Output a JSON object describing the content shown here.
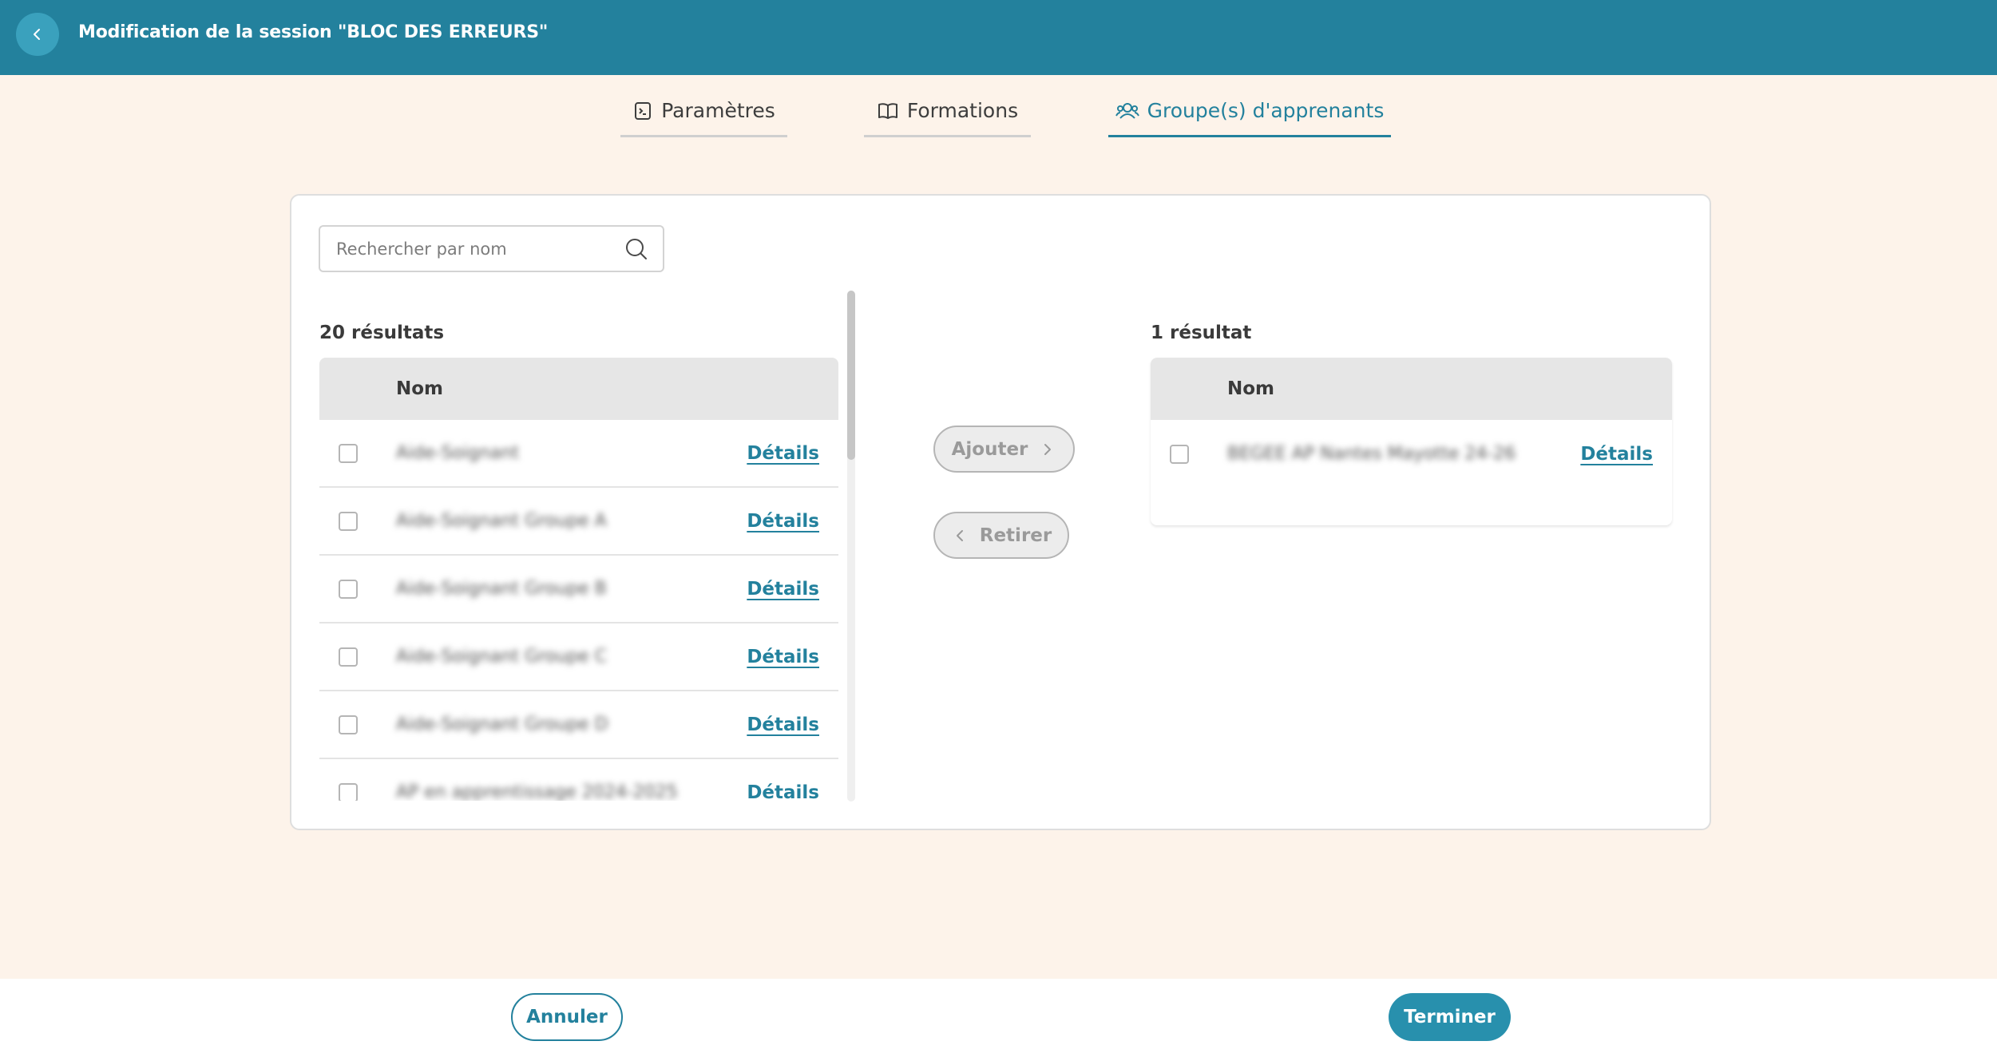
{
  "header": {
    "title": "Modification de la session \"BLOC DES ERREURS\""
  },
  "tabs": [
    {
      "label": "Paramètres",
      "icon": "settings-doc-icon"
    },
    {
      "label": "Formations",
      "icon": "book-icon"
    },
    {
      "label": "Groupe(s) d'apprenants",
      "icon": "users-icon",
      "active": true
    }
  ],
  "search": {
    "placeholder": "Rechercher par nom",
    "value": ""
  },
  "left": {
    "count": "20 résultats",
    "column": "Nom",
    "rows": [
      {
        "name": "Aide-Soignant",
        "action": "Détails"
      },
      {
        "name": "Aide-Soignant Groupe A",
        "action": "Détails"
      },
      {
        "name": "Aide-Soignant Groupe B",
        "action": "Détails"
      },
      {
        "name": "Aide-Soignant Groupe C",
        "action": "Détails"
      },
      {
        "name": "Aide-Soignant Groupe D",
        "action": "Détails"
      },
      {
        "name": "AP en apprentissage 2024-2025",
        "action": "Détails"
      }
    ]
  },
  "actions": {
    "add": "Ajouter",
    "remove": "Retirer"
  },
  "right": {
    "count": "1 résultat",
    "column": "Nom",
    "rows": [
      {
        "name": "BEGEE AP Nantes Mayotte 24-26",
        "action": "Détails"
      }
    ]
  },
  "footer": {
    "cancel": "Annuler",
    "finish": "Terminer"
  },
  "colors": {
    "primary": "#23819d",
    "background": "#fdf3ea"
  }
}
